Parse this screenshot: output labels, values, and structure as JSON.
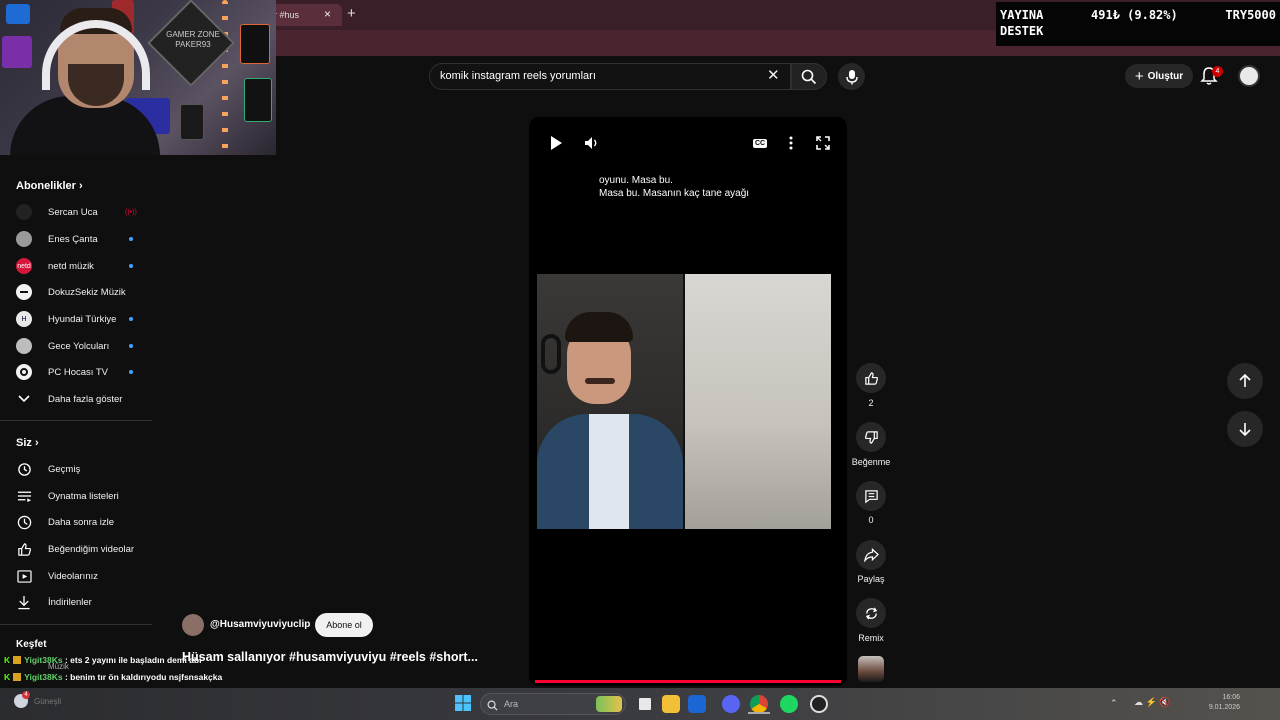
{
  "browser": {
    "tab_title": "r #hus",
    "tab_close": "×",
    "new_tab": "+"
  },
  "stats_overlay": {
    "label_line1": "YAYINA",
    "label_line2": "DESTEK",
    "value": "491₺ (9.82%)",
    "target": "TRY5000"
  },
  "webcam": {
    "poster_text": "GAMER ZONE PAKER93"
  },
  "header": {
    "search_value": "komik instagram reels yorumları",
    "search_clear": "✕",
    "create_label": "Oluştur",
    "notification_count": "4"
  },
  "sidebar": {
    "subscriptions_title": "Abonelikler",
    "subscriptions": [
      {
        "label": "Sercan Uca",
        "color": "#222222",
        "live": true
      },
      {
        "label": "Enes Çanta",
        "color": "#9a9a9a",
        "live": false
      },
      {
        "label": "netd müzik",
        "color": "#d6163a",
        "live": false
      },
      {
        "label": "DokuzSekiz Müzik",
        "color": "#f1f1f1",
        "live": false
      },
      {
        "label": "Hyundai Türkiye",
        "color": "#e8e8e8",
        "live": false
      },
      {
        "label": "Gece Yolcuları",
        "color": "#bdbdbd",
        "live": false
      },
      {
        "label": "PC Hocası TV",
        "color": "#f1f1f1",
        "live": false
      }
    ],
    "show_more": "Daha fazla göster",
    "you_title": "Siz",
    "you_items": [
      {
        "label": "Geçmiş",
        "icon": "history-icon"
      },
      {
        "label": "Oynatma listeleri",
        "icon": "playlist-icon"
      },
      {
        "label": "Daha sonra izle",
        "icon": "clock-icon"
      },
      {
        "label": "Beğendiğim videolar",
        "icon": "thumb-up-icon"
      },
      {
        "label": "Videolarınız",
        "icon": "video-icon"
      },
      {
        "label": "İndirilenler",
        "icon": "download-icon"
      }
    ],
    "explore_title": "Keşfet",
    "music": "Müzik"
  },
  "player": {
    "caption_line1": "oyunu. Masa bu.",
    "caption_line2": "Masa bu. Masanın kaç tane ayağı",
    "cc": "CC",
    "progress": 1.0
  },
  "actions": {
    "like_count": "2",
    "dislike_label": "Beğenme",
    "comment_count": "0",
    "share_label": "Paylaş",
    "remix_label": "Remix"
  },
  "channel": {
    "name": "@Husamviyuviyuclip",
    "subscribe": "Abone ol",
    "title": "Hüsam sallanıyor #husamviyuviyu #reels #short..."
  },
  "chat": [
    {
      "user": "Yigit38Ks",
      "message": ": ets 2 yayını ile başladın demi abi"
    },
    {
      "user": "Yigit38Ks",
      "message": ": benim tır ön kaldırıyodu nsjfsnsakçka"
    }
  ],
  "taskbar": {
    "search_placeholder": "Ara",
    "weather_badge": "4",
    "weather_text": "Güneşli",
    "time": "16:06",
    "date": "9.01.2026"
  }
}
